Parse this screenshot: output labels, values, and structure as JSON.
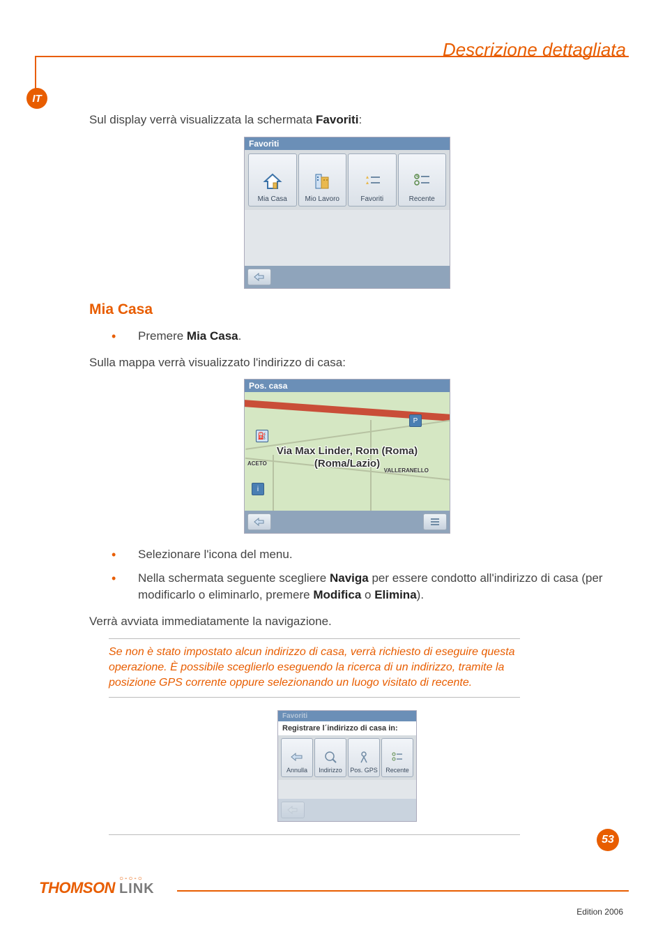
{
  "header": {
    "title": "Descrizione dettagliata"
  },
  "lang_badge": "IT",
  "intro": {
    "prefix": "Sul display verrà visualizzata la schermata ",
    "bold": "Favoriti",
    "suffix": ":"
  },
  "fav_screen": {
    "title": "Favoriti",
    "items": [
      {
        "label": "Mia Casa",
        "icon": "home-icon"
      },
      {
        "label": "Mio Lavoro",
        "icon": "work-icon"
      },
      {
        "label": "Favoriti",
        "icon": "star-list-icon"
      },
      {
        "label": "Recente",
        "icon": "recent-list-icon"
      }
    ]
  },
  "section": {
    "heading": "Mia Casa"
  },
  "bullet_press": {
    "prefix": "Premere ",
    "bold": "Mia Casa",
    "suffix": "."
  },
  "map_intro": "Sulla mappa verrà visualizzato l'indirizzo di casa:",
  "map_screen": {
    "title": "Pos. casa",
    "address_line1": "Via Max Linder, Rom (Roma)",
    "address_line2": "(Roma/Lazio)",
    "label_left": "ACETO",
    "label_right": "VALLERANELLO"
  },
  "bullet_menu": "Selezionare l'icona del menu.",
  "bullet_nav": {
    "t1": "Nella schermata seguente scegliere ",
    "b1": "Naviga",
    "t2": " per essere condotto all'indirizzo di casa (per modificarlo o eliminarlo, premere ",
    "b2": "Modifica",
    "t3": " o ",
    "b3": "Elimina",
    "t4": ")."
  },
  "after_nav": "Verrà avviata immediatamente la navigazione.",
  "note": "Se non è stato impostato alcun indirizzo di casa, verrà richiesto di eseguire questa operazione. È possibile sceglierlo eseguendo la ricerca di un indirizzo, tramite la posizione GPS corrente oppure selezionando un luogo visitato di recente.",
  "reg_screen": {
    "title": "Favoriti",
    "prompt": "Registrare l´indirizzo di casa in:",
    "items": [
      {
        "label": "Annulla",
        "icon": "back-arrow-icon"
      },
      {
        "label": "Indirizzo",
        "icon": "globe-search-icon"
      },
      {
        "label": "Pos. GPS",
        "icon": "gps-person-icon"
      },
      {
        "label": "Recente",
        "icon": "recent-list-icon"
      }
    ]
  },
  "page_number": "53",
  "logo": {
    "brand": "THOMSON",
    "sub": "LINK"
  },
  "edition": "Edition 2006"
}
